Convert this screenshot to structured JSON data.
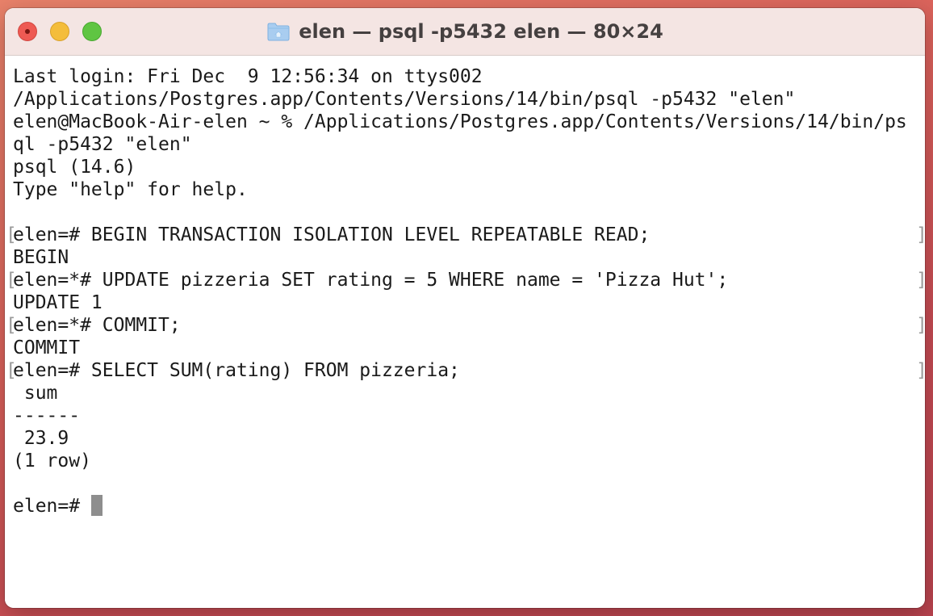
{
  "window": {
    "title": "elen — psql -p5432 elen — 80×24",
    "folder_icon": "folder-icon"
  },
  "terminal": {
    "lines": [
      "Last login: Fri Dec  9 12:56:34 on ttys002",
      "/Applications/Postgres.app/Contents/Versions/14/bin/psql -p5432 \"elen\"",
      "elen@MacBook-Air-elen ~ % /Applications/Postgres.app/Contents/Versions/14/bin/ps",
      "ql -p5432 \"elen\"",
      "psql (14.6)",
      "Type \"help\" for help.",
      "",
      "elen=# BEGIN TRANSACTION ISOLATION LEVEL REPEATABLE READ;",
      "BEGIN",
      "elen=*# UPDATE pizzeria SET rating = 5 WHERE name = 'Pizza Hut';",
      "UPDATE 1",
      "elen=*# COMMIT;",
      "COMMIT",
      "elen=# SELECT SUM(rating) FROM pizzeria;",
      " sum",
      "------",
      " 23.9",
      "(1 row)",
      "",
      "elen=# "
    ],
    "bracket_left": "[",
    "bracket_right": "]"
  },
  "colors": {
    "close": "#ee5a53",
    "minimize": "#f4bd3b",
    "maximize": "#5fc542",
    "titlebar": "#f4e5e3",
    "cursor": "#8e8e8e"
  }
}
